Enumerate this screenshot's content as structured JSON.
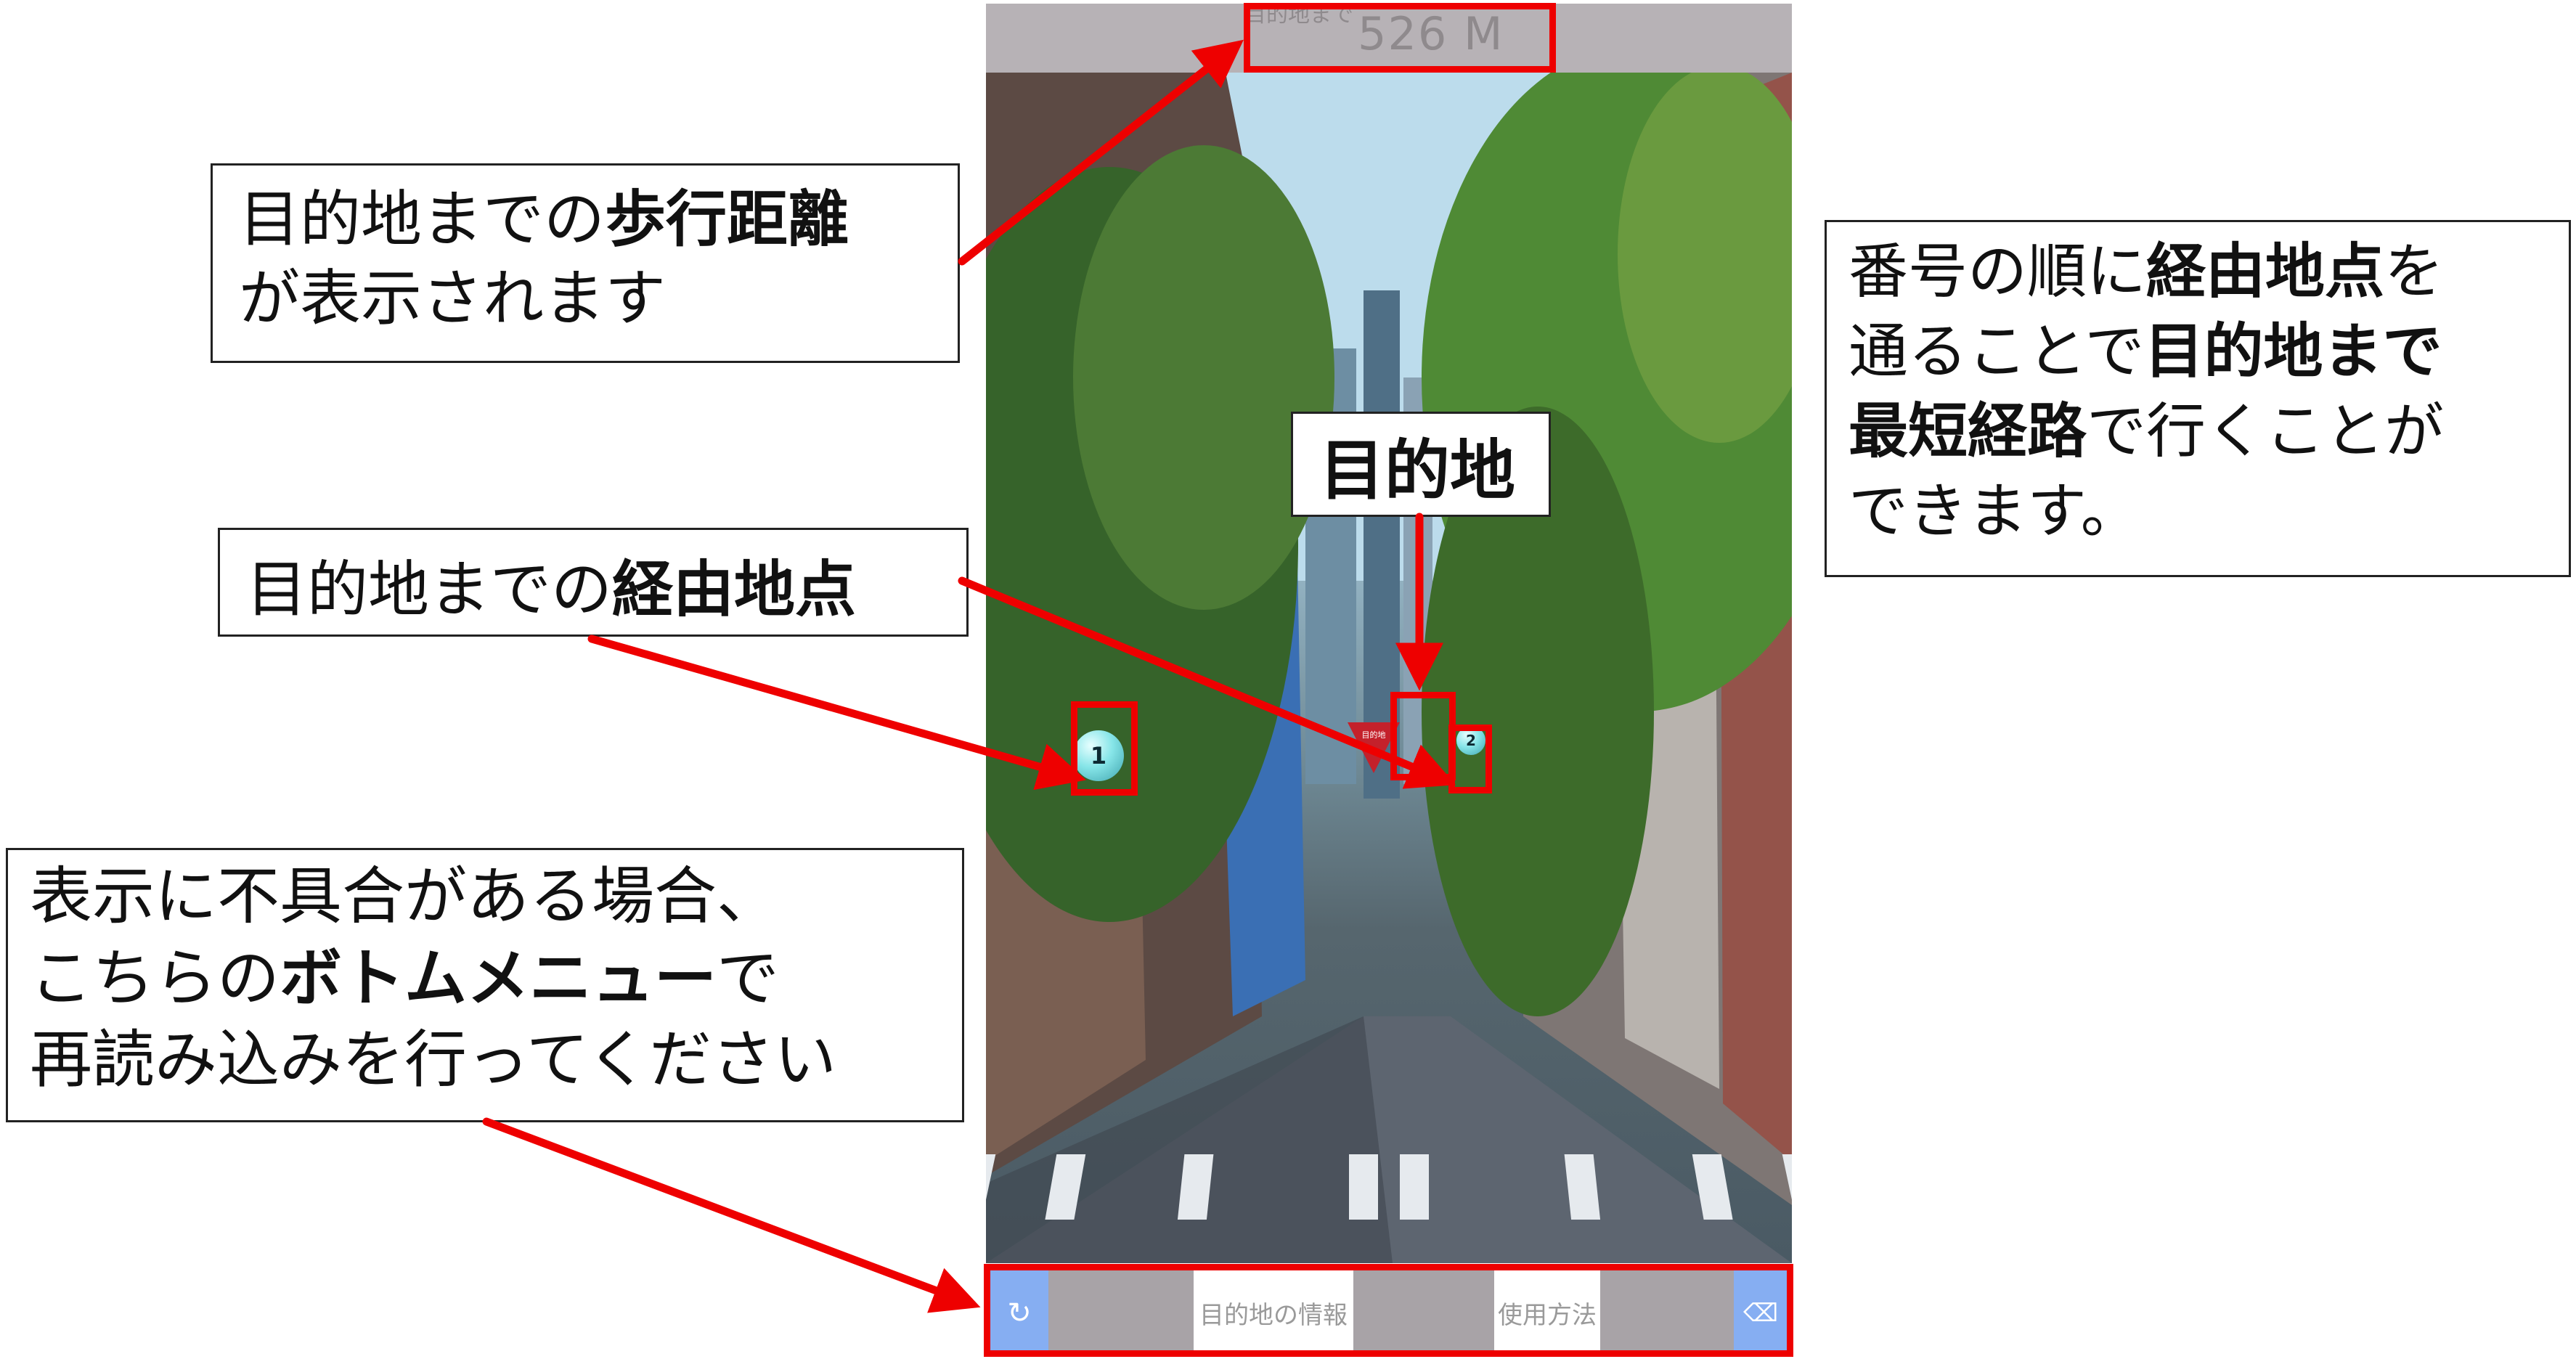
{
  "phone": {
    "top_bar": {
      "distance_label": "目的地まで",
      "distance_value": "526 M"
    },
    "bottom_menu": {
      "reload_icon": "reload-icon",
      "reload_glyph": "↻",
      "info_label": "目的地の情報",
      "howto_label": "使用方法",
      "clear_icon": "backspace-icon",
      "clear_glyph": "⌫"
    },
    "waypoints": [
      {
        "number": "1"
      },
      {
        "number": "2"
      }
    ],
    "destination_marker_label": "目的地"
  },
  "callouts": {
    "distance": {
      "line1_plain": "目的地までの",
      "line1_bold": "歩行距離",
      "line2": "が表示されます"
    },
    "waypoints": {
      "plain": "目的地までの",
      "bold": "経由地点"
    },
    "destination": {
      "text": "目的地"
    },
    "route": {
      "part1": "番号の順に",
      "bold1": "経由地点",
      "part2": "を",
      "part3": "通ることで",
      "bold2": "目的地まで",
      "bold3": "最短経路",
      "part4": "で行くことが",
      "part5": "できます。"
    },
    "menu": {
      "line1": "表示に不具合がある場合、",
      "line2_plain": "こちらの",
      "line2_bold": "ボトムメニュー",
      "line2_end": "で",
      "line3": "再読み込みを行ってください"
    }
  },
  "colors": {
    "annotation_red": "#ee0000",
    "top_bar": "#b7b2b6",
    "menu_accent": "#86aef2"
  }
}
